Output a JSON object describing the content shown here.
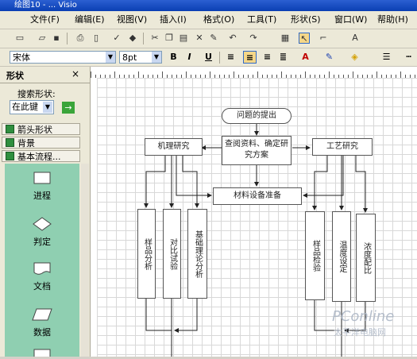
{
  "window": {
    "title": "绘图10 - ...  Visio"
  },
  "menu": [
    "文件(F)",
    "编辑(E)",
    "视图(V)",
    "插入(I)",
    "格式(O)",
    "工具(T)",
    "形状(S)",
    "窗口(W)",
    "帮助(H)"
  ],
  "toolbar": {
    "font_value": "宋体",
    "size_value": "8pt",
    "bold": "B",
    "italic": "I",
    "underline": "U",
    "font_color_icon": "A"
  },
  "shapes_panel": {
    "title": "形状",
    "close": "×",
    "search_label": "搜索形状:",
    "search_scope": "在此键",
    "go": "→",
    "stencils": [
      "箭头形状",
      "背景",
      "基本流程..."
    ],
    "shapes": [
      "进程",
      "判定",
      "文档",
      "数据"
    ]
  },
  "flowchart": {
    "top": "问题的提出",
    "center": "查阅资料、确定研究方案",
    "left": "机理研究",
    "right": "工艺研究",
    "materials": "材料设备准备",
    "left_children": [
      "样品分析",
      "对比试验",
      "基础理论分析"
    ],
    "right_children": [
      "样品检验",
      "温度设定",
      "浓度配比"
    ]
  },
  "watermark": {
    "brand": "PConline",
    "sub": "太平洋电脑网"
  }
}
